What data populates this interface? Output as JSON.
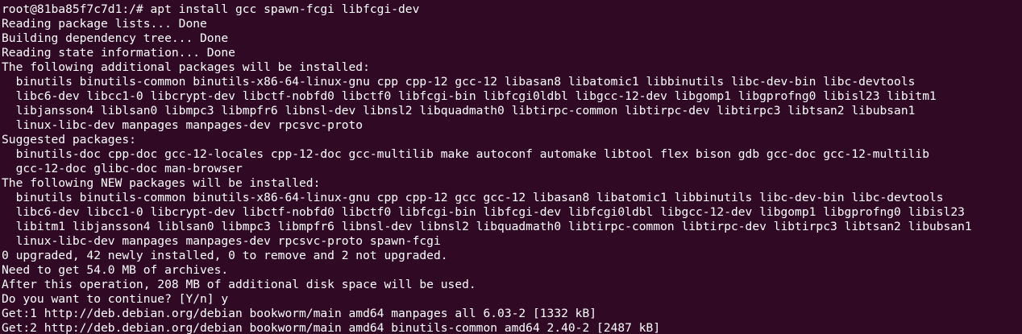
{
  "terminal": {
    "colors": {
      "background": "#300a24",
      "foreground": "#ffffff"
    },
    "lines": [
      "root@81ba85f7c7d1:/# apt install gcc spawn-fcgi libfcgi-dev",
      "Reading package lists... Done",
      "Building dependency tree... Done",
      "Reading state information... Done",
      "The following additional packages will be installed:",
      "  binutils binutils-common binutils-x86-64-linux-gnu cpp cpp-12 gcc-12 libasan8 libatomic1 libbinutils libc-dev-bin libc-devtools",
      "  libc6-dev libcc1-0 libcrypt-dev libctf-nobfd0 libctf0 libfcgi-bin libfcgi0ldbl libgcc-12-dev libgomp1 libgprofng0 libisl23 libitm1",
      "  libjansson4 liblsan0 libmpc3 libmpfr6 libnsl-dev libnsl2 libquadmath0 libtirpc-common libtirpc-dev libtirpc3 libtsan2 libubsan1",
      "  linux-libc-dev manpages manpages-dev rpcsvc-proto",
      "Suggested packages:",
      "  binutils-doc cpp-doc gcc-12-locales cpp-12-doc gcc-multilib make autoconf automake libtool flex bison gdb gcc-doc gcc-12-multilib",
      "  gcc-12-doc glibc-doc man-browser",
      "The following NEW packages will be installed:",
      "  binutils binutils-common binutils-x86-64-linux-gnu cpp cpp-12 gcc gcc-12 libasan8 libatomic1 libbinutils libc-dev-bin libc-devtools",
      "  libc6-dev libcc1-0 libcrypt-dev libctf-nobfd0 libctf0 libfcgi-bin libfcgi-dev libfcgi0ldbl libgcc-12-dev libgomp1 libgprofng0 libisl23",
      "  libitm1 libjansson4 liblsan0 libmpc3 libmpfr6 libnsl-dev libnsl2 libquadmath0 libtirpc-common libtirpc-dev libtirpc3 libtsan2 libubsan1",
      "  linux-libc-dev manpages manpages-dev rpcsvc-proto spawn-fcgi",
      "0 upgraded, 42 newly installed, 0 to remove and 2 not upgraded.",
      "Need to get 54.0 MB of archives.",
      "After this operation, 208 MB of additional disk space will be used.",
      "Do you want to continue? [Y/n] y",
      "Get:1 http://deb.debian.org/debian bookworm/main amd64 manpages all 6.03-2 [1332 kB]",
      "Get:2 http://deb.debian.org/debian bookworm/main amd64 binutils-common amd64 2.40-2 [2487 kB]"
    ]
  }
}
